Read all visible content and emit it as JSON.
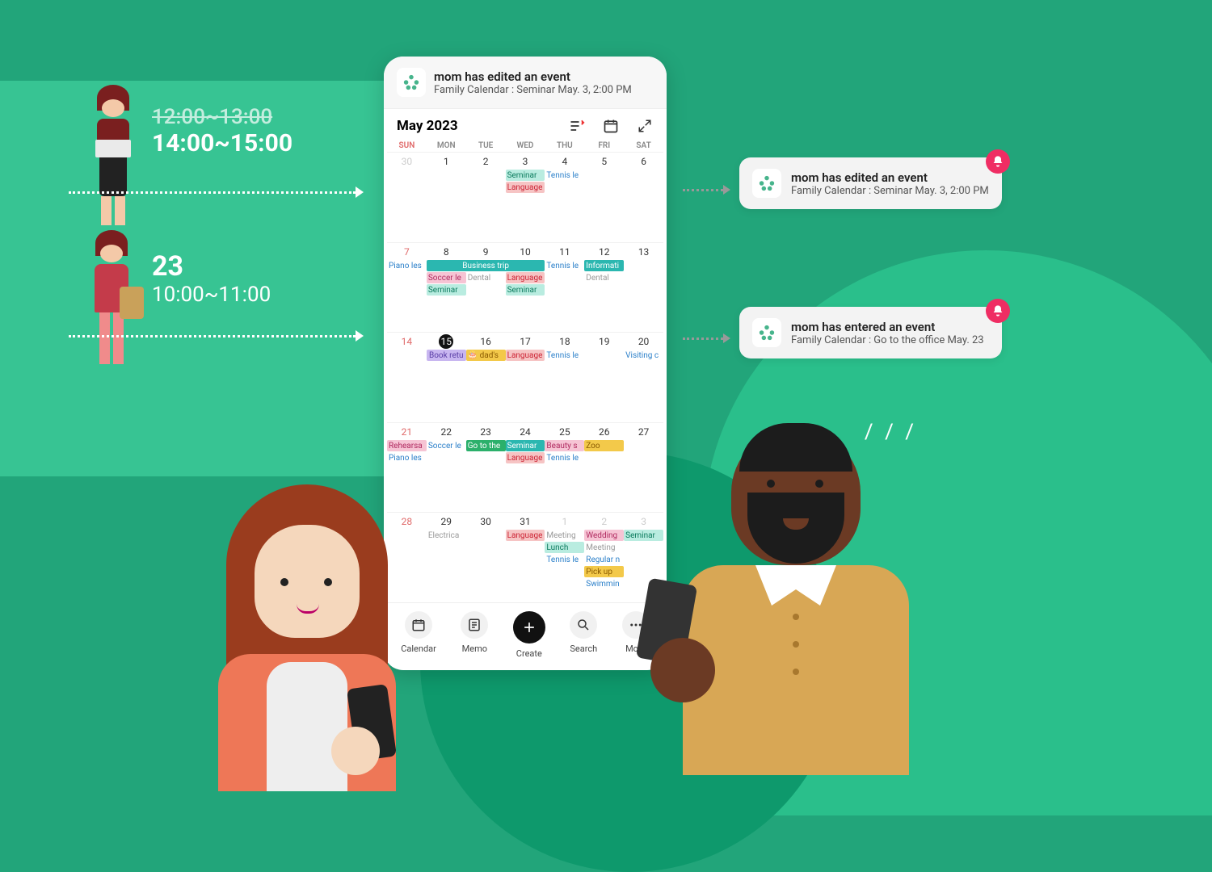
{
  "illustration": {
    "left_item1": {
      "strike_time": "12:00~13:00",
      "new_time": "14:00~15:00"
    },
    "left_item2": {
      "date": "23",
      "time": "10:00~11:00"
    }
  },
  "phone": {
    "top_notification": {
      "title": "mom has edited an event",
      "subtitle": "Family Calendar : Seminar May. 3, 2:00 PM"
    },
    "month_label": "May 2023",
    "dow": [
      "SUN",
      "MON",
      "TUE",
      "WED",
      "THU",
      "FRI",
      "SAT"
    ],
    "weeks": [
      {
        "days": [
          "30",
          "1",
          "2",
          "3",
          "4",
          "5",
          "6"
        ],
        "sun_dim": true,
        "events": [
          {
            "col": 4,
            "label": "Seminar",
            "cls": "c-teal"
          },
          {
            "col": 5,
            "label": "Tennis le",
            "cls": "c-lblue"
          },
          {
            "col": 4,
            "label": "Language",
            "cls": "c-red",
            "row": 3
          }
        ]
      },
      {
        "days": [
          "7",
          "8",
          "9",
          "10",
          "11",
          "12",
          "13"
        ],
        "events": [
          {
            "col": 1,
            "label": "Piano les",
            "cls": "c-lblue"
          },
          {
            "col": 2,
            "span": 3,
            "label": "Business trip",
            "cls": "c-bteal"
          },
          {
            "col": 5,
            "label": "Tennis le",
            "cls": "c-lblue"
          },
          {
            "col": 6,
            "label": "Informati",
            "cls": "c-bteal"
          },
          {
            "col": 2,
            "label": "Soccer le",
            "cls": "c-pink",
            "row": 3
          },
          {
            "col": 3,
            "label": "Dental",
            "cls": "c-gray",
            "row": 3
          },
          {
            "col": 4,
            "label": "Language",
            "cls": "c-red",
            "row": 3
          },
          {
            "col": 6,
            "label": "Dental",
            "cls": "c-gray",
            "row": 3
          },
          {
            "col": 2,
            "label": "Seminar",
            "cls": "c-teal",
            "row": 4
          },
          {
            "col": 4,
            "label": "Seminar",
            "cls": "c-teal",
            "row": 4
          }
        ]
      },
      {
        "days": [
          "14",
          "15",
          "16",
          "17",
          "18",
          "19",
          "20"
        ],
        "today_col": 2,
        "sel_col": 2,
        "events": [
          {
            "col": 2,
            "span": 1,
            "label": "Book retu",
            "cls": "c-purple"
          },
          {
            "col": 3,
            "label": "🎂 dad's",
            "cls": "c-yellow"
          },
          {
            "col": 4,
            "label": "Language",
            "cls": "c-red"
          },
          {
            "col": 5,
            "label": "Tennis le",
            "cls": "c-lblue"
          },
          {
            "col": 7,
            "label": "Visiting c",
            "cls": "c-lblue"
          }
        ]
      },
      {
        "days": [
          "21",
          "22",
          "23",
          "24",
          "25",
          "26",
          "27"
        ],
        "events": [
          {
            "col": 1,
            "label": "Rehearsa",
            "cls": "c-pink"
          },
          {
            "col": 2,
            "label": "Soccer le",
            "cls": "c-lblue"
          },
          {
            "col": 3,
            "label": "Go to the",
            "cls": "c-green"
          },
          {
            "col": 4,
            "label": "Seminar",
            "cls": "c-bteal"
          },
          {
            "col": 5,
            "label": "Beauty s",
            "cls": "c-pink"
          },
          {
            "col": 6,
            "label": "Zoo",
            "cls": "c-yellow"
          },
          {
            "col": 1,
            "label": "Piano les",
            "cls": "c-lblue",
            "row": 3
          },
          {
            "col": 4,
            "label": "Language",
            "cls": "c-red",
            "row": 3
          },
          {
            "col": 5,
            "label": "Tennis le",
            "cls": "c-lblue",
            "row": 3
          }
        ]
      },
      {
        "days": [
          "28",
          "29",
          "30",
          "31",
          "1",
          "2",
          "3"
        ],
        "dim_from": 5,
        "events": [
          {
            "col": 2,
            "label": "Electrica",
            "cls": "c-gray"
          },
          {
            "col": 4,
            "label": "Language",
            "cls": "c-red"
          },
          {
            "col": 5,
            "label": "Meeting",
            "cls": "c-gray"
          },
          {
            "col": 6,
            "label": "Wedding",
            "cls": "c-pink"
          },
          {
            "col": 7,
            "label": "Seminar",
            "cls": "c-teal"
          },
          {
            "col": 5,
            "label": "Lunch",
            "cls": "c-teal",
            "row": 3
          },
          {
            "col": 6,
            "label": "Meeting",
            "cls": "c-gray",
            "row": 3
          },
          {
            "col": 5,
            "label": "Tennis le",
            "cls": "c-lblue",
            "row": 4
          },
          {
            "col": 6,
            "label": "Regular n",
            "cls": "c-lblue",
            "row": 4
          },
          {
            "col": 6,
            "label": "Pick up",
            "cls": "c-yellow",
            "row": 5
          },
          {
            "col": 6,
            "label": "Swimmin",
            "cls": "c-lblue",
            "row": 6
          }
        ]
      }
    ],
    "tabs": {
      "calendar": "Calendar",
      "memo": "Memo",
      "create": "Create",
      "search": "Search",
      "more": "More"
    }
  },
  "toasts": {
    "t1": {
      "title": "mom has edited an event",
      "subtitle": "Family Calendar : Seminar May. 3, 2:00 PM"
    },
    "t2": {
      "title": "mom has entered an event",
      "subtitle": "Family Calendar : Go to the office May. 23"
    }
  }
}
